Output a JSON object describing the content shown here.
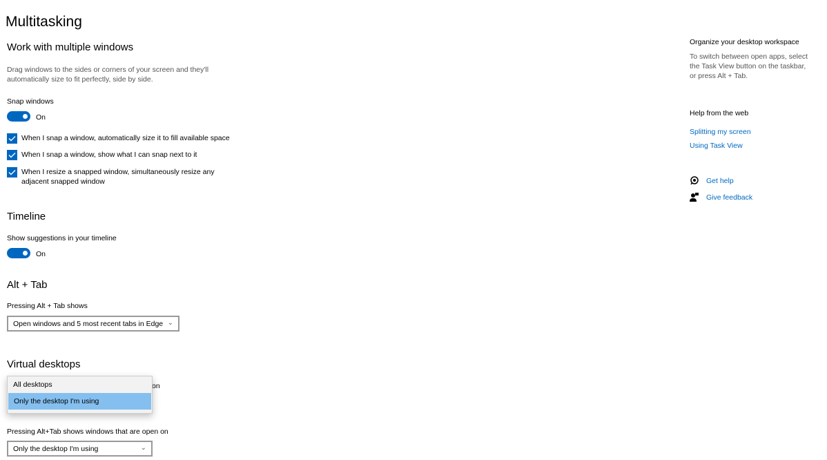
{
  "title": "Multitasking",
  "snap": {
    "heading": "Work with multiple windows",
    "description_1": "Drag windows to the sides or corners of your screen and they'll",
    "description_2": "automatically size to fit perfectly, side by side.",
    "label": "Snap windows",
    "state": "On",
    "options": [
      {
        "line1": "When I snap a window, automatically size it to fill available space",
        "checked": true
      },
      {
        "line1": "When I snap a window, show what I can snap next to it",
        "checked": true
      },
      {
        "line1": "When I resize a snapped window, simultaneously resize any",
        "line2": "adjacent snapped window",
        "checked": true
      }
    ]
  },
  "timeline": {
    "heading": "Timeline",
    "label": "Show suggestions in your timeline",
    "state": "On"
  },
  "alttab": {
    "heading": "Alt + Tab",
    "label": "Pressing Alt + Tab shows",
    "value": "Open windows and 5 most recent tabs in Edge"
  },
  "virtual": {
    "heading": "Virtual desktops",
    "taskbar_label_visible": "on",
    "dropdown_options": [
      "All desktops",
      "Only the desktop I'm using"
    ],
    "selected": "Only the desktop I'm using",
    "alttab_label": "Pressing Alt+Tab shows windows that are open on",
    "alttab_value": "Only the desktop I'm using"
  },
  "side": {
    "organize_title": "Organize your desktop workspace",
    "organize_1": "To switch between open apps, select",
    "organize_2": "the Task View button on the taskbar,",
    "organize_3": "or press Alt + Tab.",
    "help_title": "Help from the web",
    "links": [
      "Splitting my screen",
      "Using Task View"
    ],
    "get_help": "Get help",
    "feedback": "Give feedback"
  },
  "accent": "#0067c0"
}
